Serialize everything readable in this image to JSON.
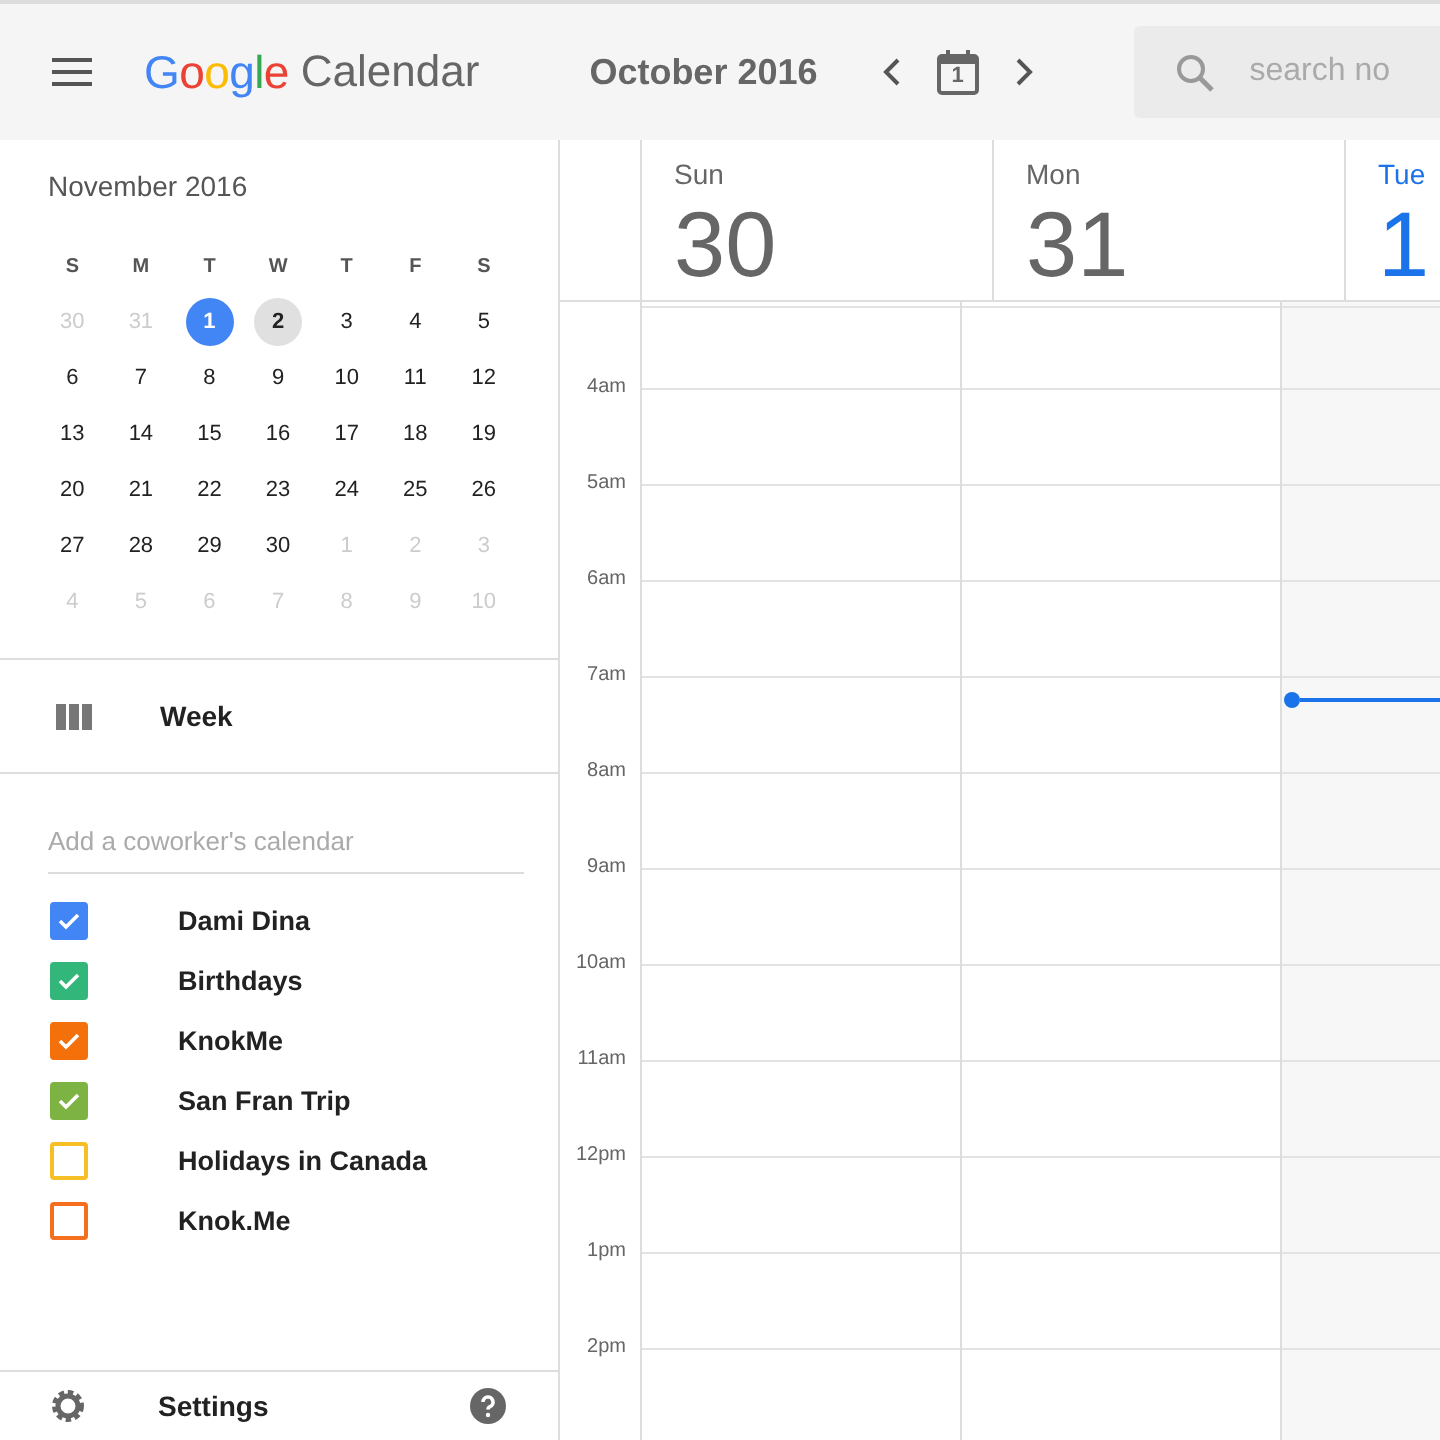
{
  "top_bar": {
    "logo": "Google",
    "product": "Calendar",
    "period": "October 2016",
    "today_button": "1",
    "search": {
      "placeholder": "search no"
    }
  },
  "mini_calendar": {
    "title": "November 2016",
    "weekdays": [
      "S",
      "M",
      "T",
      "W",
      "T",
      "F",
      "S"
    ],
    "weeks": [
      [
        {
          "label": "30",
          "outside": true,
          "today": false,
          "selected": false
        },
        {
          "label": "31",
          "outside": true,
          "today": false,
          "selected": false
        },
        {
          "label": "1",
          "outside": false,
          "today": true,
          "selected": false
        },
        {
          "label": "2",
          "outside": false,
          "today": false,
          "selected": true
        },
        {
          "label": "3",
          "outside": false,
          "today": false,
          "selected": false
        },
        {
          "label": "4",
          "outside": false,
          "today": false,
          "selected": false
        },
        {
          "label": "5",
          "outside": false,
          "today": false,
          "selected": false
        }
      ],
      [
        {
          "label": "6",
          "outside": false,
          "today": false,
          "selected": false
        },
        {
          "label": "7",
          "outside": false,
          "today": false,
          "selected": false
        },
        {
          "label": "8",
          "outside": false,
          "today": false,
          "selected": false
        },
        {
          "label": "9",
          "outside": false,
          "today": false,
          "selected": false
        },
        {
          "label": "10",
          "outside": false,
          "today": false,
          "selected": false
        },
        {
          "label": "11",
          "outside": false,
          "today": false,
          "selected": false
        },
        {
          "label": "12",
          "outside": false,
          "today": false,
          "selected": false
        }
      ],
      [
        {
          "label": "13",
          "outside": false,
          "today": false,
          "selected": false
        },
        {
          "label": "14",
          "outside": false,
          "today": false,
          "selected": false
        },
        {
          "label": "15",
          "outside": false,
          "today": false,
          "selected": false
        },
        {
          "label": "16",
          "outside": false,
          "today": false,
          "selected": false
        },
        {
          "label": "17",
          "outside": false,
          "today": false,
          "selected": false
        },
        {
          "label": "18",
          "outside": false,
          "today": false,
          "selected": false
        },
        {
          "label": "19",
          "outside": false,
          "today": false,
          "selected": false
        }
      ],
      [
        {
          "label": "20",
          "outside": false,
          "today": false,
          "selected": false
        },
        {
          "label": "21",
          "outside": false,
          "today": false,
          "selected": false
        },
        {
          "label": "22",
          "outside": false,
          "today": false,
          "selected": false
        },
        {
          "label": "23",
          "outside": false,
          "today": false,
          "selected": false
        },
        {
          "label": "24",
          "outside": false,
          "today": false,
          "selected": false
        },
        {
          "label": "25",
          "outside": false,
          "today": false,
          "selected": false
        },
        {
          "label": "26",
          "outside": false,
          "today": false,
          "selected": false
        }
      ],
      [
        {
          "label": "27",
          "outside": false,
          "today": false,
          "selected": false
        },
        {
          "label": "28",
          "outside": false,
          "today": false,
          "selected": false
        },
        {
          "label": "29",
          "outside": false,
          "today": false,
          "selected": false
        },
        {
          "label": "30",
          "outside": false,
          "today": false,
          "selected": false
        },
        {
          "label": "1",
          "outside": true,
          "today": false,
          "selected": false
        },
        {
          "label": "2",
          "outside": true,
          "today": false,
          "selected": false
        },
        {
          "label": "3",
          "outside": true,
          "today": false,
          "selected": false
        }
      ],
      [
        {
          "label": "4",
          "outside": true,
          "today": false,
          "selected": false
        },
        {
          "label": "5",
          "outside": true,
          "today": false,
          "selected": false
        },
        {
          "label": "6",
          "outside": true,
          "today": false,
          "selected": false
        },
        {
          "label": "7",
          "outside": true,
          "today": false,
          "selected": false
        },
        {
          "label": "8",
          "outside": true,
          "today": false,
          "selected": false
        },
        {
          "label": "9",
          "outside": true,
          "today": false,
          "selected": false
        },
        {
          "label": "10",
          "outside": true,
          "today": false,
          "selected": false
        }
      ]
    ]
  },
  "view": {
    "label": "Week"
  },
  "coworker_field": {
    "placeholder": "Add a coworker's calendar"
  },
  "calendars": [
    {
      "name": "Dami Dina",
      "checked": true,
      "color": "#4285f4"
    },
    {
      "name": "Birthdays",
      "checked": true,
      "color": "#33b679"
    },
    {
      "name": "KnokMe",
      "checked": true,
      "color": "#f4700a"
    },
    {
      "name": "San Fran Trip",
      "checked": true,
      "color": "#7cb342"
    },
    {
      "name": "Holidays in Canada",
      "checked": false,
      "color": "#f6bf26"
    },
    {
      "name": "Knok.Me",
      "checked": false,
      "color": "#f4701f"
    }
  ],
  "settings": {
    "label": "Settings"
  },
  "days": [
    {
      "weekday": "Sun",
      "date": "30",
      "today": false
    },
    {
      "weekday": "Mon",
      "date": "31",
      "today": false
    },
    {
      "weekday": "Tue",
      "date": "1",
      "today": true
    }
  ],
  "hours": [
    "4am",
    "5am",
    "6am",
    "7am",
    "8am",
    "9am",
    "10am",
    "11am",
    "12pm",
    "1pm",
    "2pm"
  ]
}
